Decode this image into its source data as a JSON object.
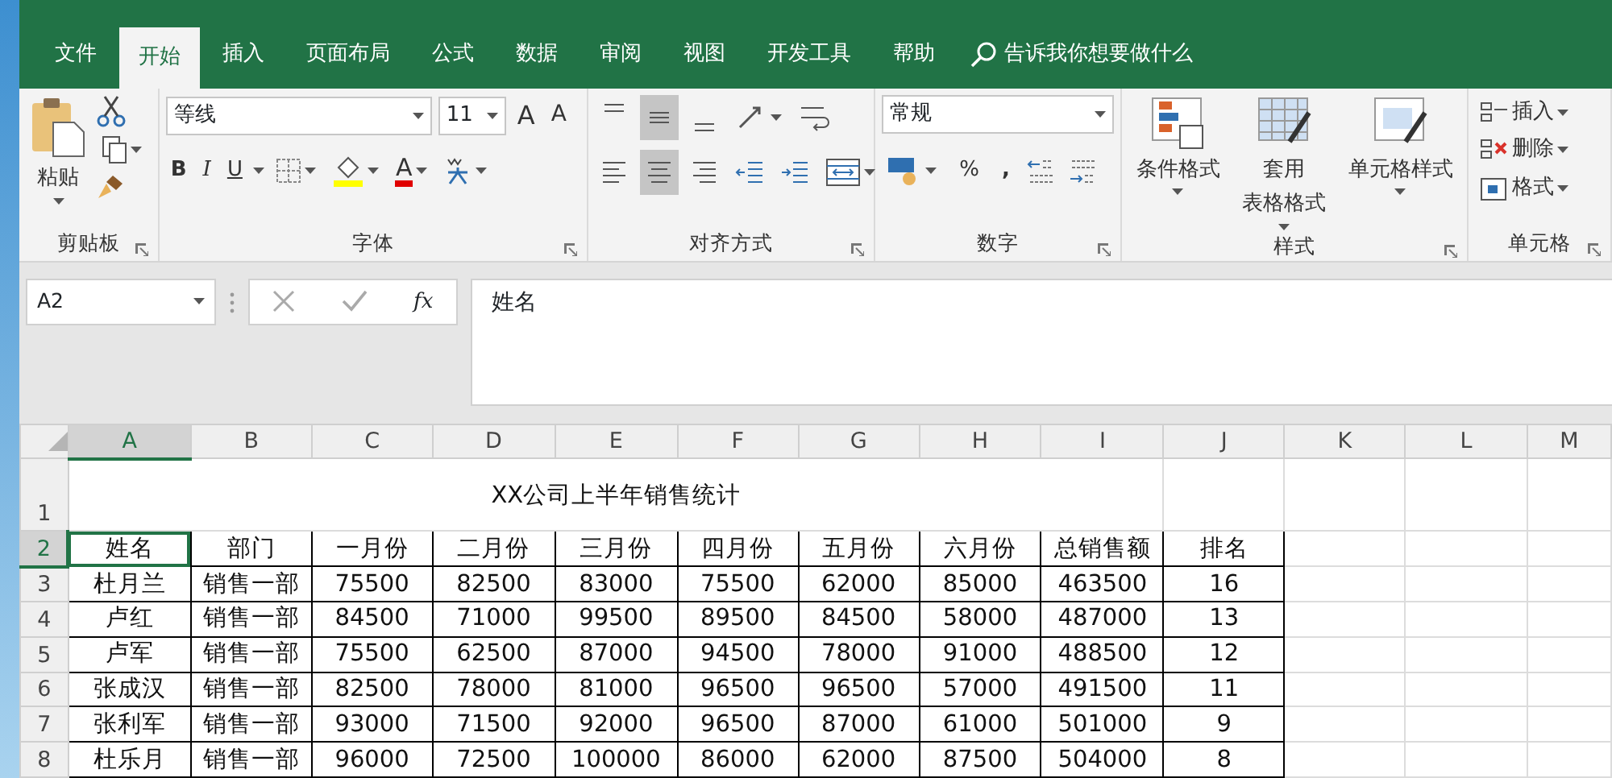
{
  "tabs": [
    {
      "label": "文件",
      "selected": false
    },
    {
      "label": "开始",
      "selected": true
    },
    {
      "label": "插入",
      "selected": false
    },
    {
      "label": "页面布局",
      "selected": false
    },
    {
      "label": "公式",
      "selected": false
    },
    {
      "label": "数据",
      "selected": false
    },
    {
      "label": "审阅",
      "selected": false
    },
    {
      "label": "视图",
      "selected": false
    },
    {
      "label": "开发工具",
      "selected": false
    },
    {
      "label": "帮助",
      "selected": false
    }
  ],
  "search": {
    "placeholder": "告诉我你想要做什么"
  },
  "ribbon": {
    "clipboard": {
      "paste": "粘贴",
      "label": "剪贴板"
    },
    "font": {
      "name": "等线",
      "size": "11",
      "grow": "A",
      "shrink": "A",
      "bold": "B",
      "italic": "I",
      "underline": "U",
      "font_color": "A",
      "label": "字体"
    },
    "alignment": {
      "vertical": [
        {
          "kind": "top",
          "selected": false
        },
        {
          "kind": "middle",
          "selected": true
        },
        {
          "kind": "bottom",
          "selected": false
        }
      ],
      "horizontal": [
        {
          "kind": "left",
          "selected": false
        },
        {
          "kind": "center",
          "selected": true
        },
        {
          "kind": "right",
          "selected": false
        }
      ],
      "label": "对齐方式"
    },
    "number": {
      "format": "常规",
      "percent": "%",
      "comma": ",",
      "label": "数字"
    },
    "styles": {
      "buttons": [
        {
          "kind": "conditional",
          "label": "条件格式"
        },
        {
          "kind": "table",
          "label": "套用",
          "label2": "表格格式"
        },
        {
          "kind": "cell",
          "label": "单元格样式"
        }
      ],
      "label": "样式"
    },
    "cells": {
      "items": [
        {
          "kind": "insert",
          "label": "插入"
        },
        {
          "kind": "delete",
          "label": "删除"
        },
        {
          "kind": "format",
          "label": "格式"
        }
      ],
      "label": "单元格"
    }
  },
  "formula_bar": {
    "name_box": "A2",
    "fx": "fx",
    "value": "姓名"
  },
  "sheet": {
    "columns": [
      {
        "label": "A",
        "selected": true
      },
      {
        "label": "B",
        "selected": false
      },
      {
        "label": "C",
        "selected": false
      },
      {
        "label": "D",
        "selected": false
      },
      {
        "label": "E",
        "selected": false
      },
      {
        "label": "F",
        "selected": false
      },
      {
        "label": "G",
        "selected": false
      },
      {
        "label": "H",
        "selected": false
      },
      {
        "label": "I",
        "selected": false
      },
      {
        "label": "J",
        "selected": false
      },
      {
        "label": "K",
        "selected": false
      },
      {
        "label": "L",
        "selected": false
      },
      {
        "label": "M",
        "selected": false
      }
    ],
    "title_row": {
      "number": "1",
      "text": "XX公司上半年销售统计"
    },
    "rows": [
      {
        "number": "2",
        "selected": true,
        "cells": [
          "姓名",
          "部门",
          "一月份",
          "二月份",
          "三月份",
          "四月份",
          "五月份",
          "六月份",
          "总销售额",
          "排名"
        ]
      },
      {
        "number": "3",
        "selected": false,
        "cells": [
          "杜月兰",
          "销售一部",
          "75500",
          "82500",
          "83000",
          "75500",
          "62000",
          "85000",
          "463500",
          "16"
        ]
      },
      {
        "number": "4",
        "selected": false,
        "cells": [
          "卢红",
          "销售一部",
          "84500",
          "71000",
          "99500",
          "89500",
          "84500",
          "58000",
          "487000",
          "13"
        ]
      },
      {
        "number": "5",
        "selected": false,
        "cells": [
          "卢军",
          "销售一部",
          "75500",
          "62500",
          "87000",
          "94500",
          "78000",
          "91000",
          "488500",
          "12"
        ]
      },
      {
        "number": "6",
        "selected": false,
        "cells": [
          "张成汉",
          "销售一部",
          "82500",
          "78000",
          "81000",
          "96500",
          "96500",
          "57000",
          "491500",
          "11"
        ]
      },
      {
        "number": "7",
        "selected": false,
        "cells": [
          "张利军",
          "销售一部",
          "93000",
          "71500",
          "92000",
          "96500",
          "87000",
          "61000",
          "501000",
          "9"
        ]
      },
      {
        "number": "8",
        "selected": false,
        "cells": [
          "杜乐月",
          "销售一部",
          "96000",
          "72500",
          "100000",
          "86000",
          "62000",
          "87500",
          "504000",
          "8"
        ]
      }
    ]
  }
}
